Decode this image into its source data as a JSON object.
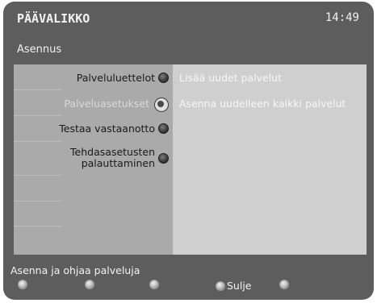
{
  "header": {
    "title": "PÄÄVALIKKO",
    "time": "14:49"
  },
  "section": {
    "title": "Asennus"
  },
  "menu": {
    "items": [
      {
        "label": "Palveluluettelot"
      },
      {
        "label": "Palveluasetukset"
      },
      {
        "label": "Testaa vastaanotto"
      },
      {
        "label": "Tehdasasetusten palauttaminen"
      }
    ]
  },
  "detail": {
    "items": [
      {
        "label": "Lisää uudet palvelut"
      },
      {
        "label": "Asenna uudelleen kaikki palvelut"
      }
    ]
  },
  "status": {
    "text": "Asenna ja ohjaa palveluja"
  },
  "keys": {
    "close_label": "Sulje"
  }
}
